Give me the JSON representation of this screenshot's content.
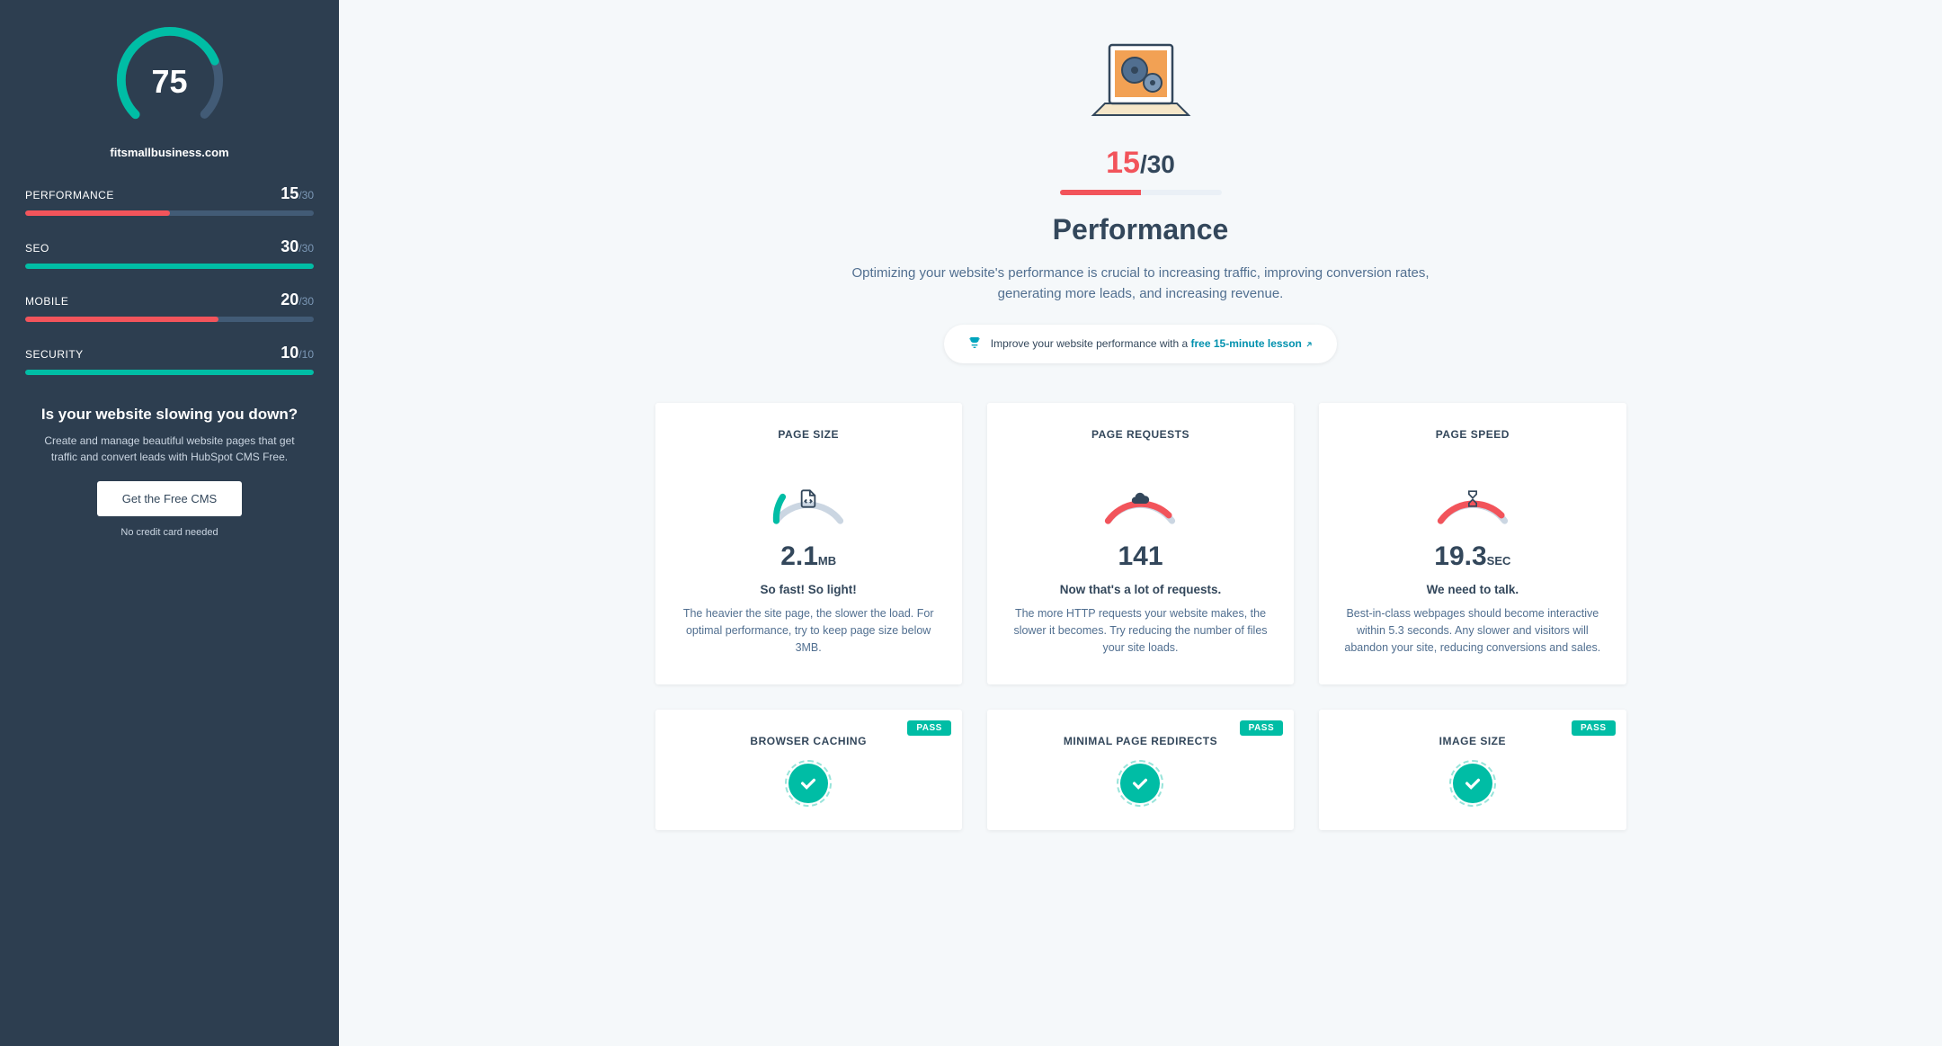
{
  "sidebar": {
    "overall_score": "75",
    "domain": "fitsmallbusiness.com",
    "metrics": [
      {
        "label": "PERFORMANCE",
        "score": "15",
        "max": "/30",
        "pct": 50,
        "color": "fill-red"
      },
      {
        "label": "SEO",
        "score": "30",
        "max": "/30",
        "pct": 100,
        "color": "fill-teal"
      },
      {
        "label": "MOBILE",
        "score": "20",
        "max": "/30",
        "pct": 67,
        "color": "fill-red"
      },
      {
        "label": "SECURITY",
        "score": "10",
        "max": "/10",
        "pct": 100,
        "color": "fill-teal"
      }
    ],
    "promo": {
      "title": "Is your website slowing you down?",
      "text": "Create and manage beautiful website pages that get traffic and convert leads with HubSpot CMS Free.",
      "button": "Get the Free CMS",
      "note": "No credit card needed"
    }
  },
  "main": {
    "score": "15",
    "score_max": "/30",
    "title": "Performance",
    "desc": "Optimizing your website's performance is crucial to increasing traffic, improving conversion rates, generating more leads, and increasing revenue.",
    "lesson_prefix": "Improve your website performance with a ",
    "lesson_link": "free 15-minute lesson",
    "cards_row1": [
      {
        "title": "PAGE SIZE",
        "value": "2.1",
        "unit": "MB",
        "tag": "So fast! So light!",
        "desc": "The heavier the site page, the slower the load. For optimal performance, try to keep page size below 3MB.",
        "gauge_color": "#00bda5",
        "gauge_pct": 22,
        "icon": "filecode"
      },
      {
        "title": "PAGE REQUESTS",
        "value": "141",
        "unit": "",
        "tag": "Now that's a lot of requests.",
        "desc": "The more HTTP requests your website makes, the slower it becomes. Try reducing the number of files your site loads.",
        "gauge_color": "#f2545b",
        "gauge_pct": 88,
        "icon": "cloud"
      },
      {
        "title": "PAGE SPEED",
        "value": "19.3",
        "unit": "SEC",
        "tag": "We need to talk.",
        "desc": "Best-in-class webpages should become interactive within 5.3 seconds. Any slower and visitors will abandon your site, reducing conversions and sales.",
        "gauge_color": "#f2545b",
        "gauge_pct": 88,
        "icon": "hourglass"
      }
    ],
    "cards_row2": [
      {
        "title": "BROWSER CACHING",
        "badge": "PASS"
      },
      {
        "title": "MINIMAL PAGE REDIRECTS",
        "badge": "PASS"
      },
      {
        "title": "IMAGE SIZE",
        "badge": "PASS"
      }
    ]
  },
  "chart_data": {
    "type": "bar",
    "title": "Website Grader Metrics",
    "categories": [
      "Performance",
      "SEO",
      "Mobile",
      "Security"
    ],
    "values": [
      15,
      30,
      20,
      10
    ],
    "max_values": [
      30,
      30,
      30,
      10
    ],
    "overall_score": 75,
    "overall_max": 100
  }
}
